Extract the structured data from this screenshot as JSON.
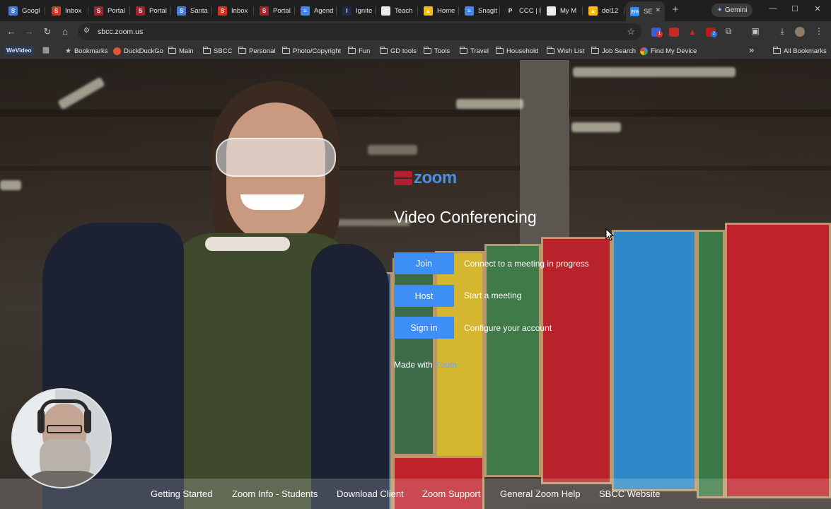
{
  "browser": {
    "tabs": [
      {
        "label": "Googl",
        "color": "#4a7ad8",
        "glyph": "S"
      },
      {
        "label": "Inbox",
        "color": "#d93025",
        "glyph": "S"
      },
      {
        "label": "Portal",
        "color": "#a4222c",
        "glyph": "S"
      },
      {
        "label": "Portal",
        "color": "#a4222c",
        "glyph": "S"
      },
      {
        "label": "Santa",
        "color": "#4a7ad8",
        "glyph": "S"
      },
      {
        "label": "Inbox",
        "color": "#d93025",
        "glyph": "S"
      },
      {
        "label": "Portal",
        "color": "#a4222c",
        "glyph": "S"
      },
      {
        "label": "Agend",
        "color": "#4285f4",
        "glyph": "≡"
      },
      {
        "label": "Ignite",
        "color": "#1b2a4a",
        "glyph": "I"
      },
      {
        "label": "Teach",
        "color": "#e8eaed",
        "glyph": "~"
      },
      {
        "label": "Home",
        "color": "#fbbc04",
        "glyph": "▲"
      },
      {
        "label": "Snagit",
        "color": "#4285f4",
        "glyph": "≡"
      },
      {
        "label": "CCC | l",
        "color": "#1f1f1f",
        "glyph": "P"
      },
      {
        "label": "My M",
        "color": "#e8eaed",
        "glyph": "▯"
      },
      {
        "label": "del12",
        "color": "#fbbc04",
        "glyph": "▲"
      },
      {
        "label": "SE",
        "color": "#2d8cff",
        "glyph": "zm",
        "active": true
      }
    ],
    "new_tab": "+",
    "gemini_label": "Gemini",
    "window_controls": {
      "minimize": "—",
      "maximize": "☐",
      "close": "✕"
    },
    "url": "sbcc.zoom.us",
    "bookmarks": {
      "wevideo": "WeVideo",
      "items": [
        "Bookmarks",
        "DuckDuckGo",
        "Main",
        "SBCC",
        "Personal",
        "Photo/Copyright",
        "Fun",
        "GD tools",
        "Tools",
        "Travel",
        "Household",
        "Wish List",
        "Job Search",
        "Find My Device"
      ],
      "overflow": "»",
      "all_bookmarks": "All Bookmarks"
    }
  },
  "page": {
    "logo_text": "zoom",
    "title": "Video Conferencing",
    "actions": [
      {
        "button": "Join",
        "description": "Connect to a meeting in progress"
      },
      {
        "button": "Host",
        "description": "Start a meeting"
      },
      {
        "button": "Sign in",
        "description": "Configure your account"
      }
    ],
    "made_with_prefix": "Made with",
    "made_with_link": "Zoom",
    "footer_links": [
      "Getting Started",
      "Zoom Info - Students",
      "Download Client",
      "Zoom Support",
      "General Zoom Help",
      "SBCC Website"
    ]
  },
  "colors": {
    "accent_button": "#3d8ef5",
    "zoom_blue": "#4a90e2",
    "sbcc_red": "#b0202e"
  }
}
